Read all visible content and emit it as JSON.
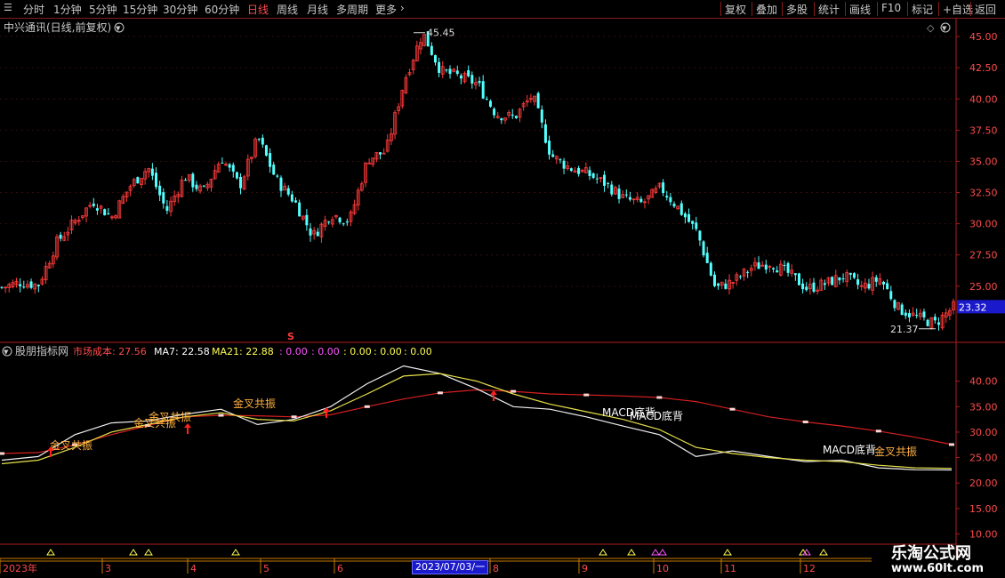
{
  "toolbar": {
    "periods": [
      "分时",
      "1分钟",
      "5分钟",
      "15分钟",
      "30分钟",
      "60分钟",
      "日线",
      "周线",
      "月线",
      "多周期",
      "更多"
    ],
    "active_period": "日线",
    "right_buttons": [
      "复权",
      "叠加",
      "多股",
      "统计",
      "画线",
      "F10",
      "标记",
      "+自选",
      "返回"
    ]
  },
  "main_panel": {
    "title": "中兴通讯(日线,前复权)",
    "high_label": "45.45",
    "low_label": "21.37",
    "current_price": "23.32",
    "signal_mark": "S"
  },
  "indicator_panel": {
    "name": "股朋指标网",
    "legend": [
      {
        "label": "市场成本: 27.56",
        "color": "#ff4b4b"
      },
      {
        "label": "MA7: 22.58",
        "color": "#ffffff"
      },
      {
        "label": "MA21: 22.88",
        "color": "#ffff55"
      },
      {
        "label": ": 0.00",
        "color": "#ff55ff"
      },
      {
        "label": ": 0.00",
        "color": "#ff55ff"
      },
      {
        "label": ": 0.00",
        "color": "#ffff55"
      },
      {
        "label": ": 0.00",
        "color": "#ffff55"
      },
      {
        "label": ": 0.00",
        "color": "#ffff55"
      }
    ],
    "annotations": [
      "金叉共振",
      "金叉共振",
      "金叉共振",
      "金叉共振",
      "MACD底背",
      "MACD底背",
      "MACD底背",
      "金叉共振"
    ]
  },
  "time_axis": {
    "labels": [
      "2023年",
      "3",
      "4",
      "5",
      "6",
      "8",
      "9",
      "10",
      "11",
      "12"
    ],
    "cursor_date": "2023/07/03/一"
  },
  "watermark": {
    "line1": "乐淘公式网",
    "line2": "www.60lt.com"
  },
  "chart_data": [
    {
      "type": "candlestick",
      "title": "中兴通讯(日线,前复权)",
      "ylim": [
        20.5,
        46.5
      ],
      "y_ticks": [
        "45.00",
        "42.50",
        "40.00",
        "37.50",
        "35.00",
        "32.50",
        "30.00",
        "27.50",
        "25.00"
      ],
      "series": [
        {
          "name": "close",
          "values": [
            24.9,
            25.3,
            25.1,
            28.5,
            30.2,
            31.8,
            30.5,
            33.0,
            34.5,
            31.0,
            33.8,
            32.5,
            35.3,
            33.0,
            36.9,
            33.5,
            31.8,
            29.0,
            30.8,
            30.2,
            35.2,
            35.8,
            41.5,
            45.3,
            42.2,
            41.8,
            41.2,
            38.8,
            38.5,
            40.3,
            35.5,
            34.5,
            34.0,
            33.2,
            32.0,
            31.6,
            32.9,
            31.2,
            29.3,
            24.8,
            25.4,
            26.5,
            26.9,
            26.0,
            24.8,
            25.2,
            25.8,
            24.9,
            25.6,
            23.2,
            22.5,
            22.0,
            23.32
          ]
        }
      ],
      "annotations": [
        {
          "text": "45.45",
          "x": 23,
          "y": 45.45
        },
        {
          "text": "21.37",
          "x": 51,
          "y": 21.37
        }
      ]
    },
    {
      "type": "line",
      "title": "股朋指标网",
      "ylim": [
        8,
        45
      ],
      "y_ticks": [
        "40.00",
        "35.00",
        "30.00",
        "25.00",
        "20.00",
        "15.00",
        "10.00"
      ],
      "x": [
        0,
        8,
        16,
        24,
        32,
        40,
        48,
        56,
        64,
        72,
        80,
        88,
        96,
        104,
        112,
        120,
        128,
        136,
        144,
        152,
        160,
        168,
        176,
        184,
        192,
        200,
        208
      ],
      "series": [
        {
          "name": "市场成本",
          "values": [
            25.8,
            26.0,
            27.5,
            29.5,
            31.3,
            33.0,
            33.3,
            33.2,
            33.0,
            33.4,
            35.0,
            36.5,
            37.7,
            38.3,
            38.0,
            37.5,
            37.3,
            37.1,
            36.8,
            36.0,
            34.5,
            33.0,
            32.0,
            31.2,
            30.2,
            29.0,
            27.56
          ]
        },
        {
          "name": "MA7",
          "values": [
            24.5,
            25.2,
            29.5,
            31.8,
            32.2,
            33.5,
            34.5,
            31.5,
            32.5,
            35.0,
            39.5,
            43.0,
            41.5,
            38.5,
            35.0,
            34.5,
            33.0,
            31.2,
            29.5,
            25.2,
            26.3,
            25.2,
            24.2,
            24.5,
            23.0,
            22.6,
            22.58
          ]
        },
        {
          "name": "MA21",
          "values": [
            23.8,
            24.5,
            27.0,
            30.0,
            31.5,
            33.0,
            33.8,
            32.5,
            32.2,
            34.2,
            37.5,
            41.0,
            41.5,
            40.0,
            37.5,
            35.5,
            34.0,
            32.5,
            30.5,
            27.0,
            25.8,
            25.0,
            24.5,
            24.2,
            23.5,
            23.0,
            22.88
          ]
        }
      ]
    }
  ]
}
